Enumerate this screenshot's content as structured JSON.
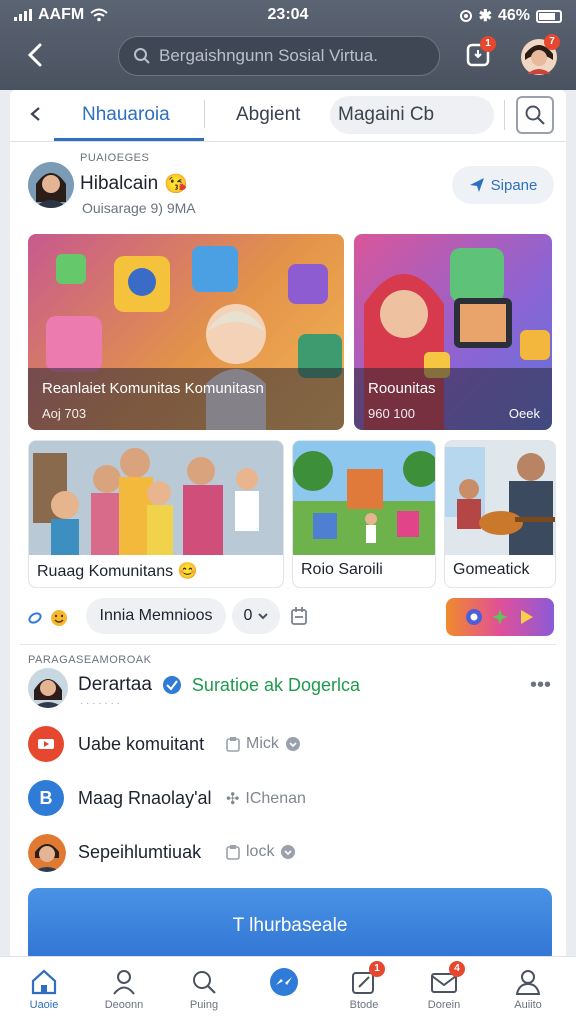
{
  "status_bar": {
    "carrier": "AAFM",
    "time": "23:04",
    "battery": "46%"
  },
  "top_bar": {
    "search_placeholder": "Bergaishngunn Sosial Virtua.",
    "notification_count": "1",
    "profile_badge": "7"
  },
  "tabs": {
    "items": [
      "Nhauaroia",
      "Abgient",
      "Magaini Cb"
    ]
  },
  "post": {
    "meta_label": "PUAIOEGES",
    "author": "Hibalcain",
    "author_emoji": "😘",
    "subtitle": "Ouisarage 9) 9MA",
    "share_label": "Sipane"
  },
  "featured": [
    {
      "title": "Reanlaiet Komunitas Komunitasn",
      "sub": "Aoj 703",
      "right": ""
    },
    {
      "title": "Roounitas",
      "sub": "960 100",
      "right": "Oeek"
    }
  ],
  "tiles": [
    {
      "caption": "Ruaag Komunitans",
      "emoji": "😊"
    },
    {
      "caption": "Roio Saroili"
    },
    {
      "caption": "Gomeatick"
    }
  ],
  "actions": {
    "chip_main": "Innia Memnioos",
    "chip_count": "0"
  },
  "feed": {
    "section_label": "PARAGASEAMOROAK",
    "header_name": "Derartaa",
    "header_link": "Suratioe ak Dogerlca",
    "header_sub": "· · · · · · ·",
    "rows": [
      {
        "title": "Uabe komuitant",
        "meta": "Mick",
        "icon_color": "#e5482f"
      },
      {
        "title": "Maag Rnaolay'al",
        "meta": "IChenan",
        "icon_color": "#2e7bd8"
      },
      {
        "title": "Sepeihlumtiuak",
        "meta": "lock",
        "icon_color": "#c0632a"
      }
    ]
  },
  "cta": {
    "label": "T lhurbaseale"
  },
  "bottom_nav": [
    {
      "label": "Uaoie",
      "badge": ""
    },
    {
      "label": "Deoonn",
      "badge": ""
    },
    {
      "label": "Puing",
      "badge": ""
    },
    {
      "label": "",
      "badge": ""
    },
    {
      "label": "Btode",
      "badge": "1"
    },
    {
      "label": "Dorein",
      "badge": "4"
    },
    {
      "label": "Auiito",
      "badge": ""
    }
  ],
  "colors": {
    "accent": "#2e6fc0",
    "badge": "#e5482f",
    "link_green": "#1e9a4c"
  }
}
